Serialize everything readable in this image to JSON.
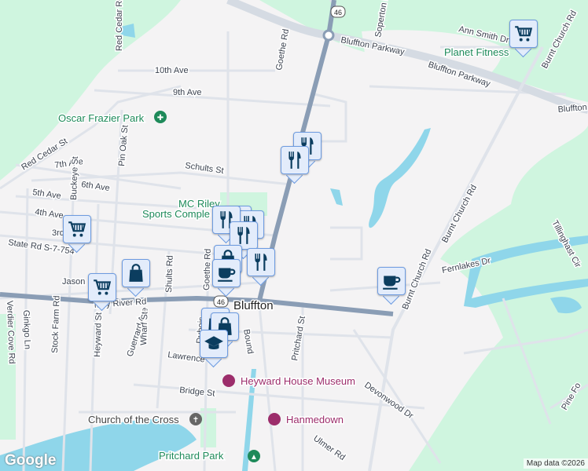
{
  "map": {
    "roads": {
      "10th_ave": "10th Ave",
      "9th_ave": "9th Ave",
      "red_cedar_rd": "Red Cedar Rd",
      "goethe_rd_top": "Goethe Rd",
      "soperton": "Soperton Dr",
      "ann_smith": "Ann Smith Dr",
      "bluffton_pkwy_1": "Bluffton Parkway",
      "bluffton_pkwy_2": "Bluffton Parkway",
      "bluffton_pkwy_3": "Bluffton",
      "burnt_church_1": "Burnt Church Rd",
      "burnt_church_2": "Burnt Church Rd",
      "burnt_church_3": "Burnt Church Rd",
      "red_cedar_st": "Red Cedar St",
      "pin_oak": "Pin Oak St",
      "7th_ave": "7th Ave",
      "6th_ave": "6th Ave",
      "5th_ave": "5th Ave",
      "4th_ave": "4th Ave",
      "3rd": "3rd",
      "buckeye": "Buckeye St",
      "schults_st": "Schults St",
      "state_rd": "State Rd S-7-754",
      "jason": "Jason",
      "may_river": "May River Rd",
      "shults_rd": "Shults Rd",
      "goethe_rd": "Goethe Rd",
      "ginkgo": "Ginkgo Ln",
      "verdier": "Verdier Cove Rd",
      "stock_farm": "Stock Farm Rd",
      "heyward": "Heyward St",
      "guerrard": "Guerrard Ave",
      "wharf": "Wharf St",
      "dubois": "Dubois",
      "boundary": "Bound",
      "lawrence": "Lawrence",
      "pritchard_st": "Pritchard St",
      "fernlakes": "Fernlakes Dr",
      "tillinghast": "Tillinghast Cir",
      "bridge": "Bridge St",
      "devonwood": "Devonwood Dr",
      "ulmer": "Ulmer Rd",
      "pine_fo": "Pine Fo",
      "highway_shield": "46"
    },
    "places": {
      "oscar_frazier": "Oscar Frazier Park",
      "mc_riley_1": "MC Riley",
      "mc_riley_2": "Sports Comple",
      "planet_fitness": "Planet Fitness",
      "bluffton": "Bluffton",
      "heyward_house": "Heyward House Museum",
      "church_cross": "Church of the Cross",
      "hanmedown": "Hanmedown",
      "pritchard_park": "Pritchard Park"
    },
    "google_logo": "Google",
    "attribution": "Map data ©2026",
    "colors": {
      "marker_fill": "#e3ecfb",
      "marker_border": "#6d9be0",
      "icon": "#0b3d5f",
      "park": "#cff5df",
      "water": "#8fd6ea",
      "highway": "#8a9db5"
    }
  },
  "markers": [
    {
      "type": "grocery-cart"
    },
    {
      "type": "restaurant"
    },
    {
      "type": "restaurant"
    },
    {
      "type": "restaurant"
    },
    {
      "type": "restaurant"
    },
    {
      "type": "restaurant"
    },
    {
      "type": "restaurant"
    },
    {
      "type": "shopping-bag"
    },
    {
      "type": "cafe"
    },
    {
      "type": "restaurant"
    },
    {
      "type": "grocery-cart"
    },
    {
      "type": "shopping-bag"
    },
    {
      "type": "grocery-cart"
    },
    {
      "type": "shopping-bag"
    },
    {
      "type": "shopping-bag"
    },
    {
      "type": "school"
    },
    {
      "type": "cafe"
    }
  ]
}
